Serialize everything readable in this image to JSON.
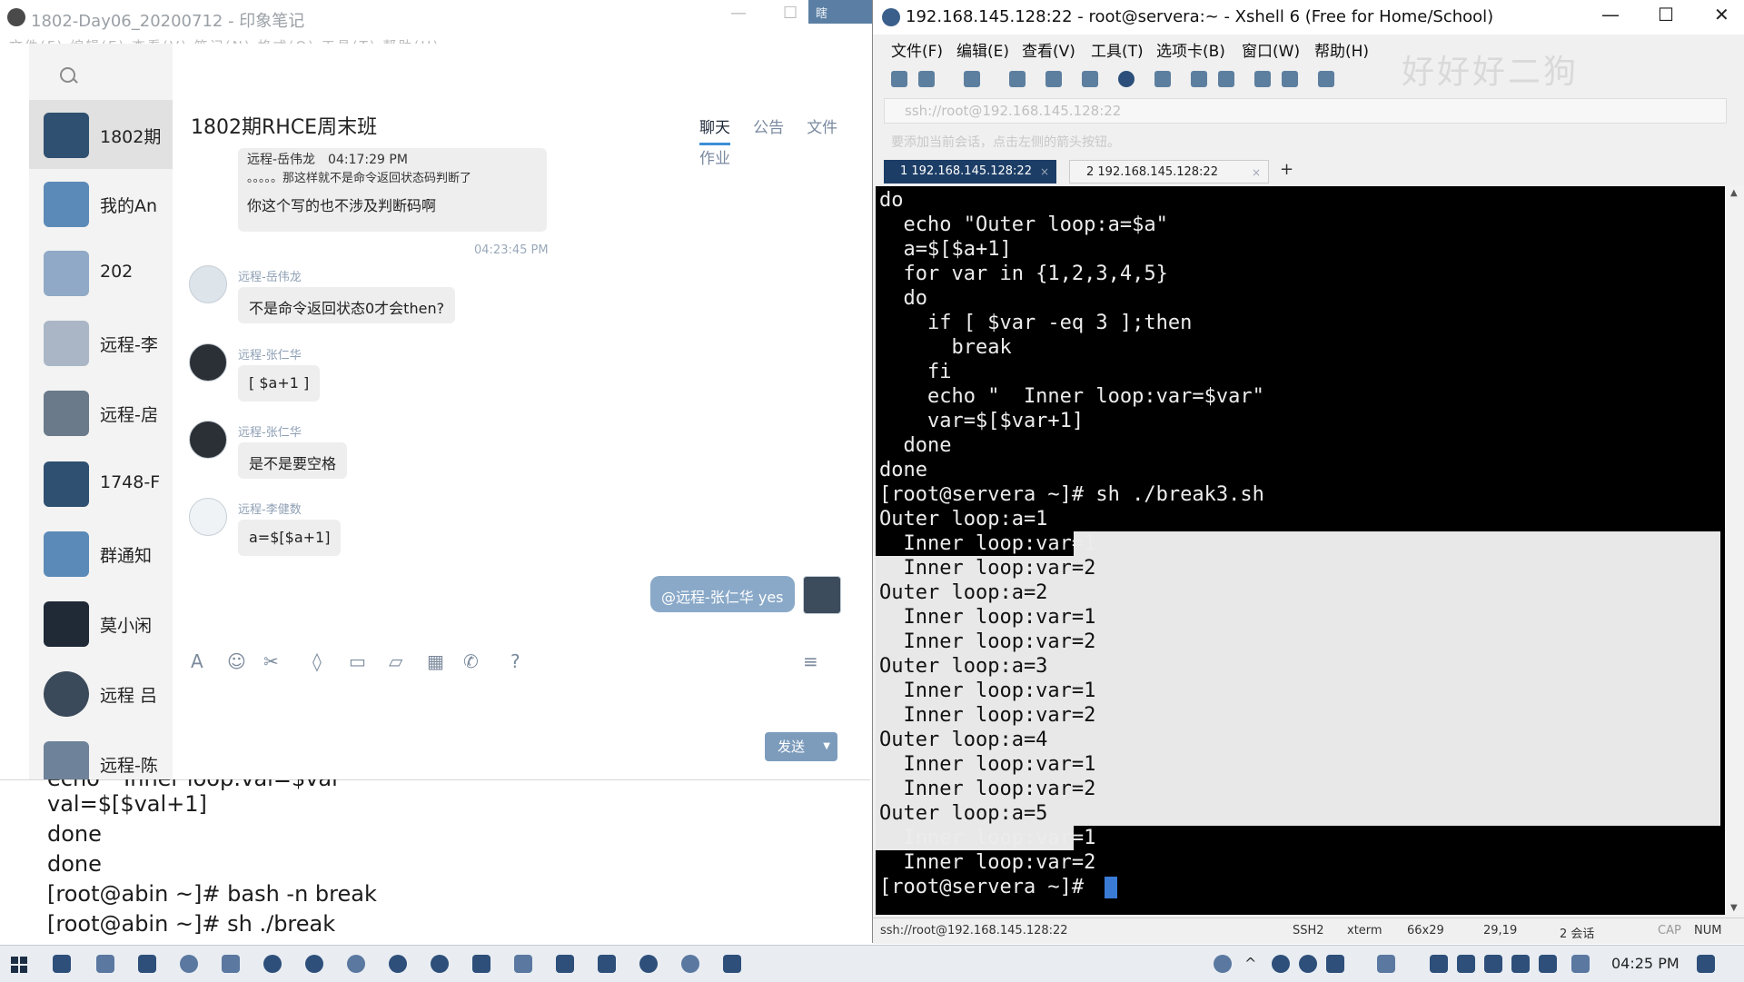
{
  "evernote": {
    "title": "1802-Day06_20200712 - 印象笔记",
    "menu_partial": "文件(F)  编辑(E)  查看(V)  笔记(N)  格式(O)  工具(T)  帮助(H)",
    "overflow_tab": "瞎",
    "code_lines": [
      "echo \"  Inner loop:val=$val\"",
      "val=$[$val+1]",
      "done",
      "done",
      "[root@abin ~]# bash -n break",
      "[root@abin ~]# sh ./break"
    ]
  },
  "qq": {
    "contacts": [
      {
        "name": "1802期"
      },
      {
        "name": "我的An"
      },
      {
        "name": "202"
      },
      {
        "name": "远程-李"
      },
      {
        "name": "远程-扂"
      },
      {
        "name": "1748-F"
      },
      {
        "name": "群通知"
      },
      {
        "name": "莫小闲"
      },
      {
        "name": "远程 吕"
      },
      {
        "name": "远程-陈"
      }
    ],
    "chat_title": "1802期RHCE周末班",
    "tabs": [
      "聊天",
      "公告",
      "文件",
      "作业"
    ],
    "quote": {
      "meta": "远程-岳伟龙　04:17:29 PM",
      "quoted": "。。。。。那这样就不是命令返回状态码判断了",
      "reply": "你这个写的也不涉及判断码啊"
    },
    "timestamp": "04:23:45 PM",
    "messages": [
      {
        "name": "远程-岳伟龙",
        "text": "不是命令返回状态0才会then?"
      },
      {
        "name": "远程-张仁华",
        "text": "[ $a+1 ]"
      },
      {
        "name": "远程-张仁华",
        "text": "是不是要空格"
      },
      {
        "name": "远程-李健数",
        "text": "a=$[$a+1]"
      }
    ],
    "my_message": "@远程-张仁华 yes",
    "send_label": "发送",
    "toolbar_icons": [
      "font-icon",
      "emoji-icon",
      "scissors-icon",
      "shield-icon",
      "image-icon",
      "folder-icon",
      "gift-icon",
      "phone-icon",
      "help-icon"
    ]
  },
  "xshell": {
    "title": "192.168.145.128:22 - root@servera:~ - Xshell 6 (Free for Home/School)",
    "menu": [
      "文件(F)",
      "编辑(E)",
      "查看(V)",
      "工具(T)",
      "选项卡(B)",
      "窗口(W)",
      "帮助(H)"
    ],
    "watermark": "好好好二狗",
    "address": "ssh://root@192.168.145.128:22",
    "hint": "要添加当前会话，点击左侧的箭头按钮。",
    "tabs": [
      {
        "label": "1 192.168.145.128:22",
        "active": true
      },
      {
        "label": "2 192.168.145.128:22",
        "active": false
      }
    ],
    "terminal_lines": [
      "do",
      "  echo \"Outer loop:a=$a\"",
      "  a=$[$a+1]",
      "  for var in {1,2,3,4,5}",
      "  do",
      "    if [ $var -eq 3 ];then",
      "      break",
      "    fi",
      "    echo \"  Inner loop:var=$var\"",
      "    var=$[$var+1]",
      "  done",
      "done",
      "[root@servera ~]# sh ./break3.sh",
      "Outer loop:a=1",
      "  Inner loop:var=1",
      "  Inner loop:var=2",
      "Outer loop:a=2",
      "  Inner loop:var=1",
      "  Inner loop:var=2",
      "Outer loop:a=3",
      "  Inner loop:var=1",
      "  Inner loop:var=2",
      "Outer loop:a=4",
      "  Inner loop:var=1",
      "  Inner loop:var=2",
      "Outer loop:a=5",
      "  Inner loop:var=1",
      "  Inner loop:var=2",
      "[root@servera ~]# "
    ],
    "status": {
      "conn": "ssh://root@192.168.145.128:22",
      "proto": "SSH2",
      "term": "xterm",
      "size": "66x29",
      "pos": "29,19",
      "sessions": "2 会话",
      "cap": "CAP",
      "num": "NUM"
    },
    "colors": {
      "tab_active": "#1c3d66",
      "selection": "#e8e8e8",
      "terminal_bg": "#000000"
    }
  },
  "taskbar": {
    "clock": "04:25 PM"
  }
}
